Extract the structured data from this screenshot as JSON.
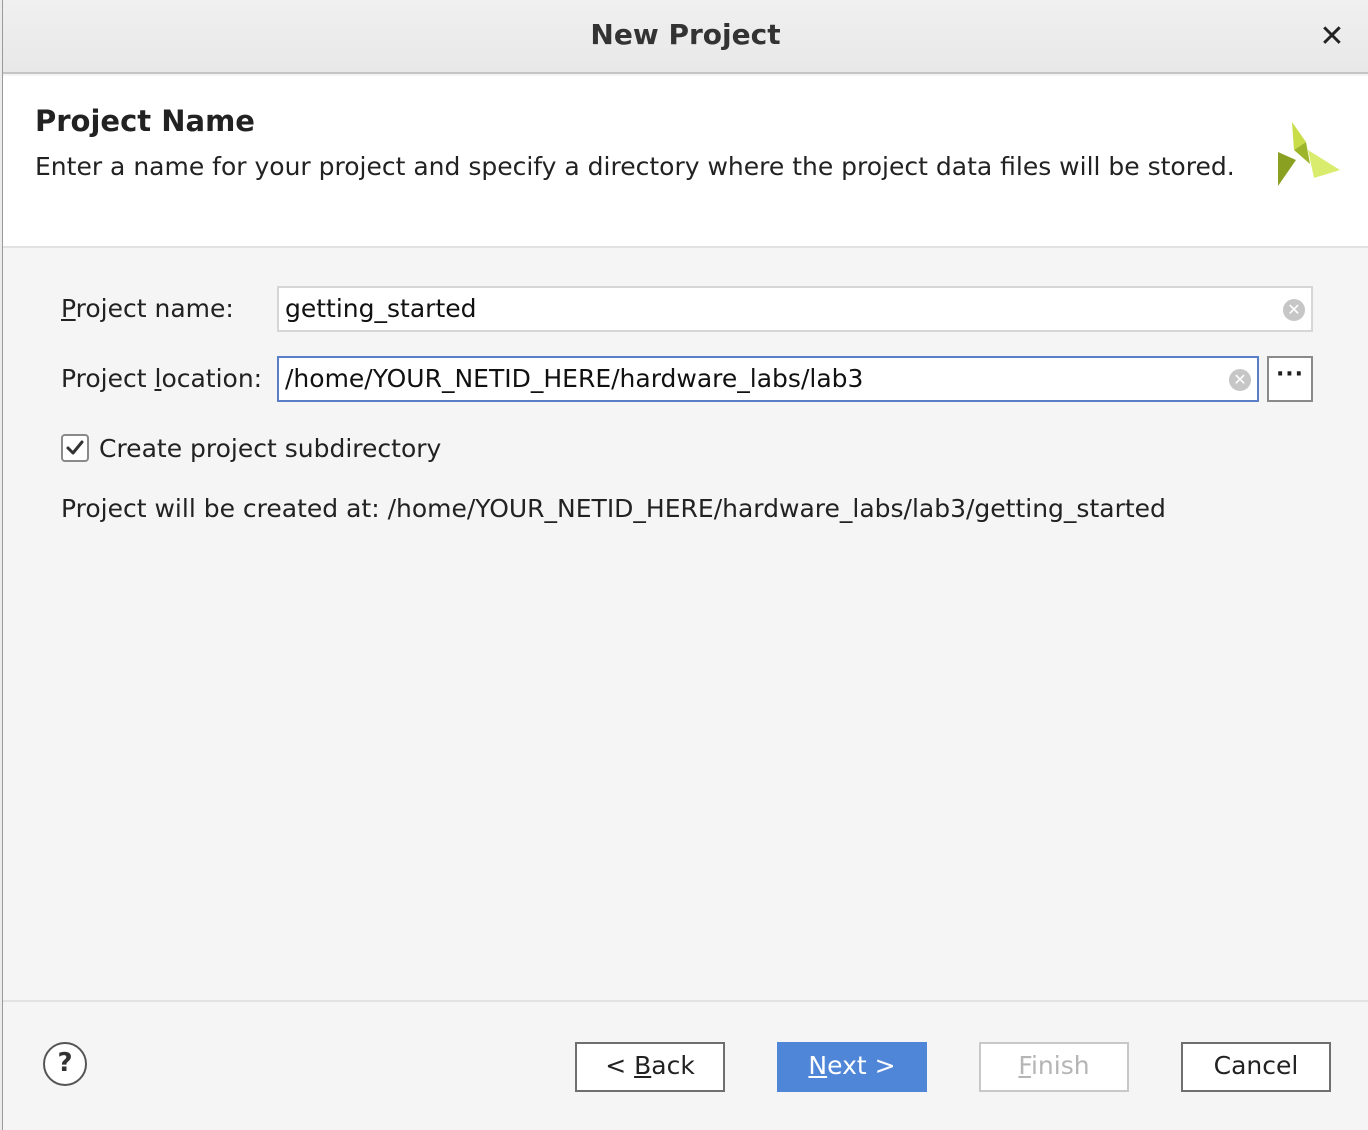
{
  "window": {
    "title": "New Project"
  },
  "header": {
    "title": "Project Name",
    "description": "Enter a name for your project and specify a directory where the project data files will be stored."
  },
  "form": {
    "project_name": {
      "label_mnemonic": "P",
      "label_rest": "roject name:",
      "value": "getting_started"
    },
    "project_location": {
      "label_prefix": "Project ",
      "label_mnemonic": "l",
      "label_rest": "ocation:",
      "value": "/home/YOUR_NETID_HERE/hardware_labs/lab3",
      "browse_label": "···"
    },
    "create_subdirectory": {
      "label": "Create project subdirectory",
      "checked": true
    },
    "created_at": "Project will be created at: /home/YOUR_NETID_HERE/hardware_labs/lab3/getting_started"
  },
  "footer": {
    "help_label": "?",
    "back": {
      "prefix": "< ",
      "mnemonic": "B",
      "rest": "ack"
    },
    "next": {
      "mnemonic": "N",
      "rest": "ext >"
    },
    "finish": {
      "mnemonic": "F",
      "rest": "inish"
    },
    "cancel": "Cancel"
  },
  "colors": {
    "accent": "#4f86d8",
    "focus_border": "#5a7fc8",
    "logo_dark": "#8aa020",
    "logo_light": "#d4e85a"
  }
}
